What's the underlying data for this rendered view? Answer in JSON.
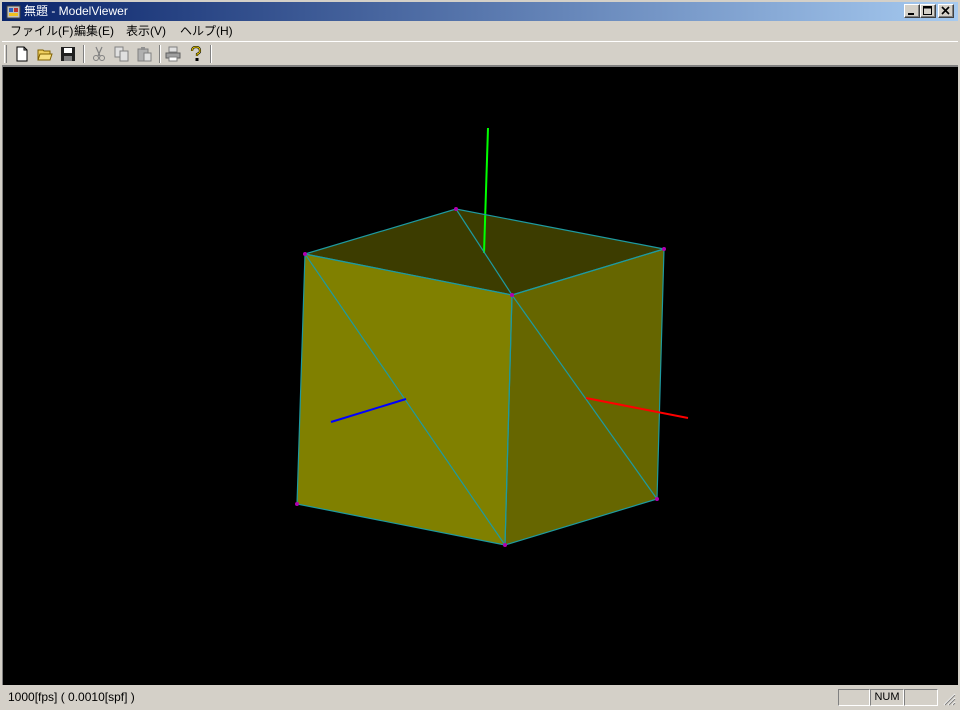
{
  "window": {
    "title": "無題 - ModelViewer",
    "controls": [
      "minimize-icon",
      "maximize-icon",
      "close-icon"
    ]
  },
  "menu": {
    "items": [
      {
        "label": "ファイル(F)"
      },
      {
        "label": "編集(E)"
      },
      {
        "label": "表示(V)"
      },
      {
        "label": "ヘルプ(H)"
      }
    ]
  },
  "toolbar": {
    "buttons": [
      "new-file-icon",
      "open-folder-icon",
      "save-icon",
      "cut-icon",
      "copy-icon",
      "paste-icon",
      "print-icon",
      "help-icon"
    ]
  },
  "viewport": {
    "background": "#000000",
    "model": "cube",
    "face_colors": {
      "front": "#808000",
      "right": "#666600",
      "top": "#3c3c00"
    },
    "edge_color": "#1e9aa0",
    "vertex_color": "#b000b0",
    "axes": {
      "x": "#ff0000",
      "y": "#00ff00",
      "z": "#0000ff"
    }
  },
  "statusbar": {
    "text": "1000[fps] ( 0.0010[spf] )",
    "num_indicator": "NUM"
  }
}
